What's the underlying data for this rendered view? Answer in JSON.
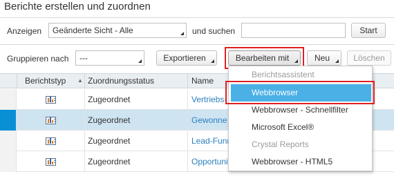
{
  "page": {
    "title": "Berichte  erstellen und zuordnen"
  },
  "filter": {
    "show_label": "Anzeigen",
    "view_value": "Geänderte Sicht - Alle",
    "search_label": "und suchen",
    "search_value": "",
    "start_button": "Start"
  },
  "toolbar": {
    "group_label": "Gruppieren nach",
    "group_value": "---",
    "export_button": "Exportieren",
    "edit_with_button": "Bearbeiten mit",
    "new_button": "Neu",
    "delete_button": "Löschen"
  },
  "table": {
    "columns": [
      "Berichtstyp",
      "Zuordnungsstatus",
      "Name"
    ],
    "sort_indicator": "▲",
    "rows": [
      {
        "status": "Zugeordnet",
        "name": "Vertriebs-",
        "selected": false,
        "icon": "report-icon"
      },
      {
        "status": "Zugeordnet",
        "name": "Gewonne",
        "selected": true,
        "icon": "report-icon"
      },
      {
        "status": "Zugeordnet",
        "name": "Lead-Funn",
        "selected": false,
        "icon": "report-icon"
      },
      {
        "status": "Zugeordnet",
        "name": "Opportunity-Funnel",
        "selected": false,
        "icon": "report-icon"
      }
    ]
  },
  "menu": {
    "items": [
      {
        "label": "Berichtsassistent",
        "disabled": true
      },
      {
        "label": "Webbrowser",
        "highlight": true
      },
      {
        "label": "Webbrowser - Schnellfilter"
      },
      {
        "label": "Microsoft Excel®"
      },
      {
        "label": "Crystal Reports",
        "disabled": true
      },
      {
        "label": "Webbrowser - HTML5"
      }
    ]
  },
  "colors": {
    "selection_strip": "#0a8fd7",
    "selected_row": "#cfe4f1",
    "menu_highlight": "#4ab0e6",
    "annotation_outline": "#e02020",
    "link": "#2a7fbf"
  }
}
